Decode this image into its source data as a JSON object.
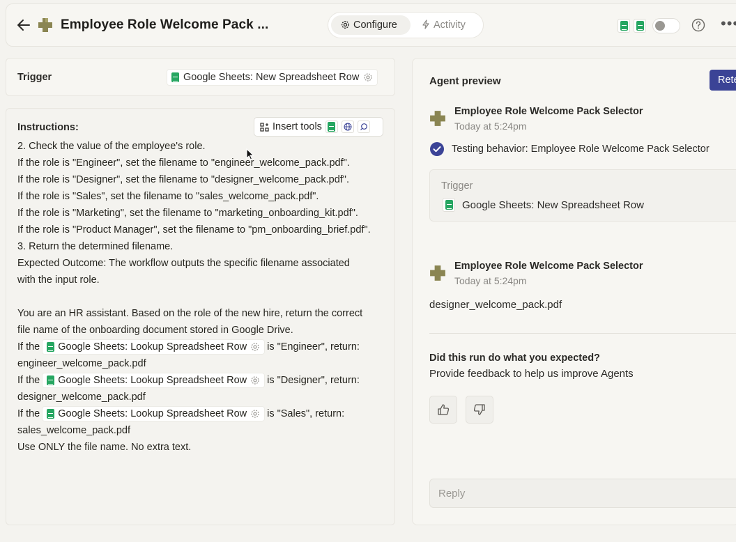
{
  "header": {
    "title": "Employee Role Welcome Pack ...",
    "tabs": [
      {
        "label": "Configure",
        "icon": "gear-icon",
        "active": true
      },
      {
        "label": "Activity",
        "icon": "bolt-icon",
        "active": false
      }
    ]
  },
  "trigger": {
    "label": "Trigger",
    "value": "Google Sheets: New Spreadsheet Row"
  },
  "instructions": {
    "label": "Instructions:",
    "insert_tools": "Insert tools",
    "lines": [
      "2. Check the value of the employee's role.",
      "If the role is \"Engineer\", set the filename to \"engineer_welcome_pack.pdf\".",
      "If the role is \"Designer\", set the filename to \"designer_welcome_pack.pdf\".",
      "If the role is \"Sales\", set the filename to \"sales_welcome_pack.pdf\".",
      "If the role is \"Marketing\", set the filename to \"marketing_onboarding_kit.pdf\".",
      "If the role is \"Product Manager\", set the filename to \"pm_onboarding_brief.pdf\".",
      "3. Return the determined filename.",
      "Expected Outcome: The workflow outputs the specific filename associated",
      "with the input role.",
      "You are an HR assistant. Based on the role of the new hire, return the correct",
      "file name of the onboarding document stored in Google Drive."
    ],
    "rules": [
      {
        "prefix": "If the",
        "chip": "Google Sheets: Lookup Spreadsheet Row",
        "suffix": "is \"Engineer\", return:",
        "result": "engineer_welcome_pack.pdf"
      },
      {
        "prefix": "If the",
        "chip": "Google Sheets: Lookup Spreadsheet Row",
        "suffix": "is \"Designer\", return:",
        "result": "designer_welcome_pack.pdf"
      },
      {
        "prefix": "If the",
        "chip": "Google Sheets: Lookup Spreadsheet Row",
        "suffix": "is \"Sales\", return:",
        "result": "sales_welcome_pack.pdf"
      }
    ],
    "closing": "Use ONLY the file name. No extra text."
  },
  "preview": {
    "title": "Agent preview",
    "retest_label": "Retest",
    "messages": [
      {
        "name": "Employee Role Welcome Pack Selector",
        "time": "Today at 5:24pm"
      },
      {
        "name": "Employee Role Welcome Pack Selector",
        "time": "Today at 5:24pm"
      }
    ],
    "testing_text": "Testing behavior: Employee Role Welcome Pack Selector",
    "trigger_box": {
      "label": "Trigger",
      "value": "Google Sheets: New Spreadsheet Row"
    },
    "result": "designer_welcome_pack.pdf",
    "feedback_question": "Did this run do what you expected?",
    "feedback_sub": "Provide feedback to help us improve Agents",
    "reply_placeholder": "Reply"
  },
  "colors": {
    "accent": "#3b4396",
    "sheets_green": "#26a661",
    "logo_olive": "#8a8552",
    "check_blue": "#3b4396"
  }
}
